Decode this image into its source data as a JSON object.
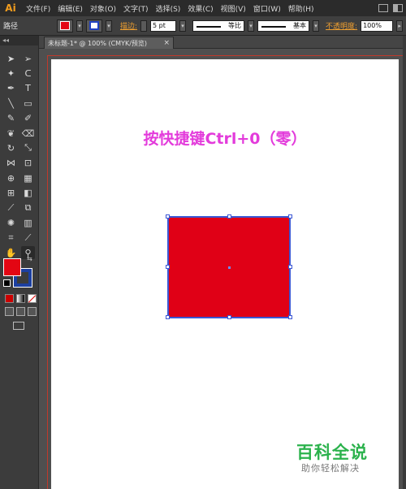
{
  "app": {
    "logo": "Ai"
  },
  "menu": [
    "文件(F)",
    "编辑(E)",
    "对象(O)",
    "文字(T)",
    "选择(S)",
    "效果(C)",
    "视图(V)",
    "窗口(W)",
    "帮助(H)"
  ],
  "control_bar": {
    "selection_label": "路径",
    "fill_color": "#e30613",
    "stroke_color": "#2040c0",
    "stroke_label": "描边:",
    "stroke_weight": "5 pt",
    "profile_label": "等比",
    "brush_label": "基本",
    "opacity_label": "不透明度:",
    "opacity_value": "100%"
  },
  "document_tab": {
    "title": "未标题-1* @ 100% (CMYK/预览)",
    "close": "×"
  },
  "tools": {
    "header": "◂◂",
    "items": [
      {
        "name": "selection-tool",
        "glyph": "➤"
      },
      {
        "name": "direct-selection-tool",
        "glyph": "➢"
      },
      {
        "name": "magic-wand-tool",
        "glyph": "✦"
      },
      {
        "name": "lasso-tool",
        "glyph": "ᑕ"
      },
      {
        "name": "pen-tool",
        "glyph": "✒"
      },
      {
        "name": "type-tool",
        "glyph": "T"
      },
      {
        "name": "line-tool",
        "glyph": "╲"
      },
      {
        "name": "rectangle-tool",
        "glyph": "▭"
      },
      {
        "name": "paintbrush-tool",
        "glyph": "✎"
      },
      {
        "name": "pencil-tool",
        "glyph": "✐"
      },
      {
        "name": "blob-brush-tool",
        "glyph": "❦"
      },
      {
        "name": "eraser-tool",
        "glyph": "⌫"
      },
      {
        "name": "rotate-tool",
        "glyph": "↻"
      },
      {
        "name": "scale-tool",
        "glyph": "⤡"
      },
      {
        "name": "width-tool",
        "glyph": "⋈"
      },
      {
        "name": "free-transform-tool",
        "glyph": "⊡"
      },
      {
        "name": "shape-builder-tool",
        "glyph": "⊕"
      },
      {
        "name": "perspective-grid-tool",
        "glyph": "▦"
      },
      {
        "name": "mesh-tool",
        "glyph": "⊞"
      },
      {
        "name": "gradient-tool",
        "glyph": "◧"
      },
      {
        "name": "eyedropper-tool",
        "glyph": "⟋"
      },
      {
        "name": "blend-tool",
        "glyph": "⧉"
      },
      {
        "name": "symbol-sprayer-tool",
        "glyph": "✺"
      },
      {
        "name": "column-graph-tool",
        "glyph": "▥"
      },
      {
        "name": "artboard-tool",
        "glyph": "⌗"
      },
      {
        "name": "slice-tool",
        "glyph": "⟋"
      },
      {
        "name": "hand-tool",
        "glyph": "✋"
      },
      {
        "name": "zoom-tool",
        "glyph": "⚲"
      }
    ]
  },
  "swatches": {
    "fill": "#e30613",
    "stroke": "#1c3fa0"
  },
  "canvas": {
    "hint_text": "按快捷键Ctrl+0（零）",
    "shape_fill": "#e00016",
    "selection_color": "#3b57d4"
  },
  "watermark": {
    "title": "百科全说",
    "subtitle": "助你轻松解决"
  }
}
